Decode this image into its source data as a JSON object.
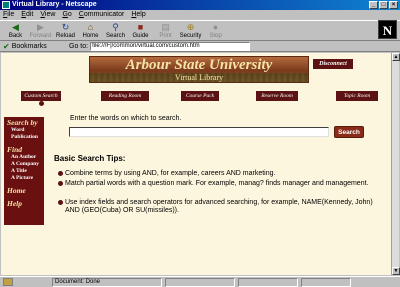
{
  "window": {
    "title": "Virtual Library - Netscape"
  },
  "menu": [
    "File",
    "Edit",
    "View",
    "Go",
    "Communicator",
    "Help"
  ],
  "toolbar": {
    "buttons": [
      {
        "label": "Back",
        "icon": "back-arrow-icon",
        "enabled": true
      },
      {
        "label": "Forward",
        "icon": "forward-arrow-icon",
        "enabled": false
      },
      {
        "label": "Reload",
        "icon": "reload-icon",
        "enabled": true
      },
      {
        "label": "Home",
        "icon": "home-icon",
        "enabled": true
      },
      {
        "label": "Search",
        "icon": "search-icon",
        "enabled": true
      },
      {
        "label": "Guide",
        "icon": "guide-icon",
        "enabled": true
      },
      {
        "label": "Print",
        "icon": "print-icon",
        "enabled": false
      },
      {
        "label": "Security",
        "icon": "lock-icon",
        "enabled": true
      },
      {
        "label": "Stop",
        "icon": "stop-icon",
        "enabled": false
      }
    ]
  },
  "location": {
    "bookmarks_label": "Bookmarks",
    "goto_label": "Go to:",
    "url": "file:///F|/common/virtual.com/custom.htm"
  },
  "page": {
    "university": "Arbour State University",
    "subtitle": "Virtual Library",
    "disconnect": "Disconnect",
    "tabs": [
      "Custom Search",
      "Reading Room",
      "Course Pack",
      "Reserve Room",
      "Topic Room"
    ],
    "leftnav": {
      "search_by": "Search by",
      "search_items": [
        "Word",
        "Publication"
      ],
      "find": "Find",
      "find_items": [
        "An Author",
        "A Company",
        "A Title",
        "A Picture"
      ],
      "home": "Home",
      "help": "Help"
    },
    "search": {
      "prompt": "Enter the words on which to search.",
      "value": "",
      "button": "Search"
    },
    "tips": {
      "heading": "Basic Search Tips:",
      "items": [
        "Combine terms by using AND, for example, careers AND marketing.",
        "Match partial words with a question mark. For example, manag? finds manager and management.",
        "Use index fields and search operators for advanced searching, for example, NAME(Kennedy, John) AND (GEO(Cuba) OR SU(missiles))."
      ]
    }
  },
  "status": {
    "text": "Document: Done"
  },
  "colors": {
    "accent": "#5c1212",
    "page_bg": "#fdf6de",
    "titlebar": "#000080"
  }
}
